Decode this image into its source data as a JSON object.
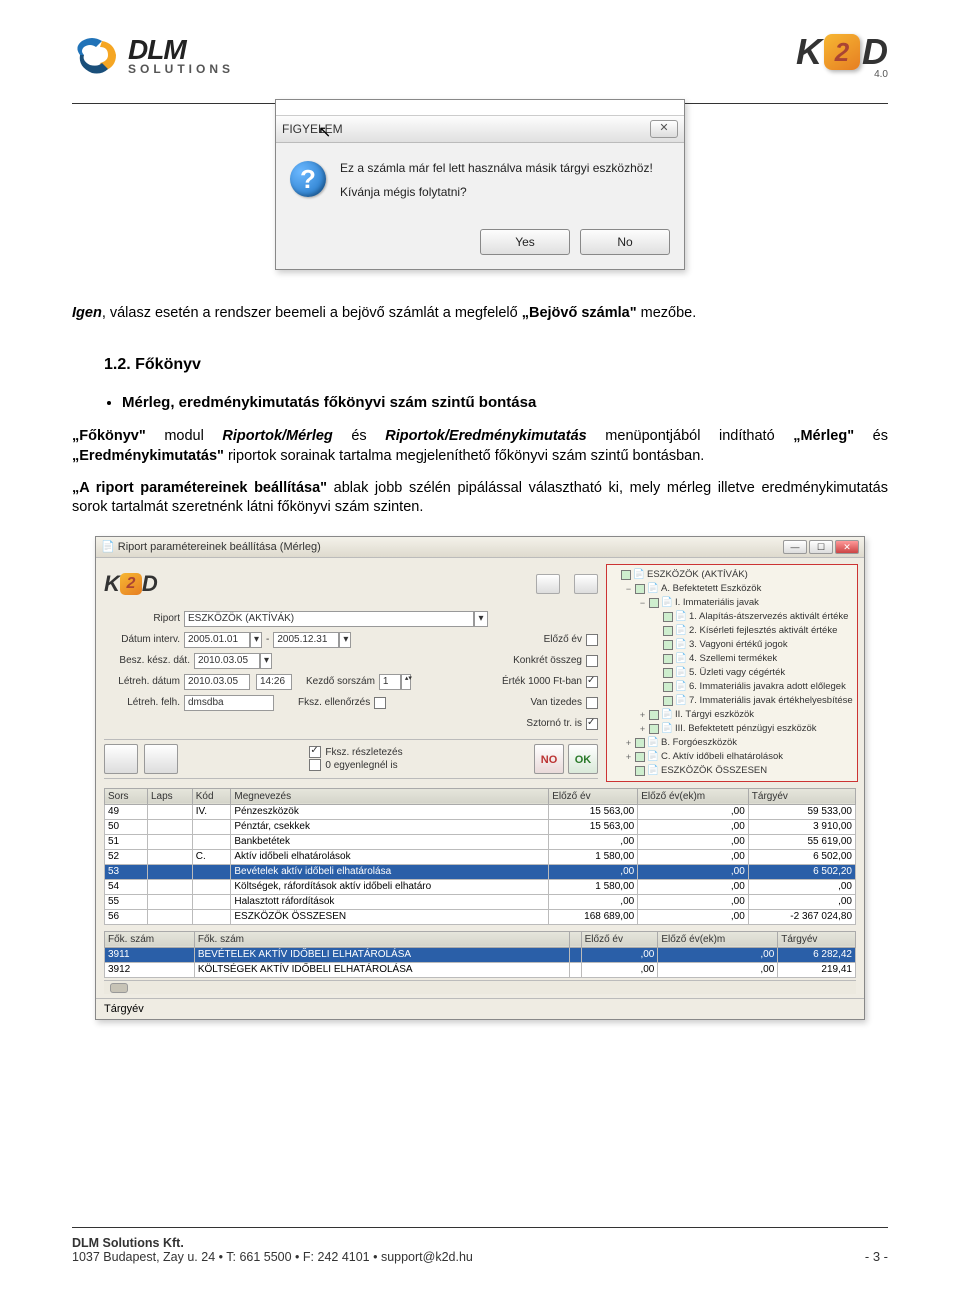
{
  "header": {
    "dlm_line1": "DLM",
    "dlm_line2": "SOLUTIONS",
    "k2d_k": "K",
    "k2d_2": "2",
    "k2d_d": "D",
    "k2d_ver": "4.0"
  },
  "dialog1": {
    "title": "FIGYELEM",
    "line1": "Ez a számla már fel lett használva másik tárgyi eszközhöz!",
    "line2": "Kívánja mégis folytatni?",
    "yes": "Yes",
    "no": "No",
    "close": "✕"
  },
  "body": {
    "p1a": "Igen",
    "p1b": ", válasz esetén a rendszer beemeli a bejövő számlát a megfelelő ",
    "p1c": "„Bejövő számla\"",
    "p1d": " mezőbe.",
    "sect": "1.2.   Főkönyv",
    "bullet": "Mérleg, eredménykimutatás főkönyvi szám szintű bontása",
    "p2a": "„Főkönyv\"",
    "p2b": " modul ",
    "p2c": "Riportok/Mérleg",
    "p2d": " és ",
    "p2e": "Riportok/Eredménykimutatás",
    "p2f": " menüpontjából indítható ",
    "p2g": "„Mérleg\"",
    "p2h": " és ",
    "p2i": "„Eredménykimutatás\"",
    "p2j": " riportok sorainak tartalma megjeleníthető főkönyvi szám szintű bontásban.",
    "p3a": "„A riport paramétereinek beállítása\"",
    "p3b": " ablak jobb szélén pipálással választható ki, mely mérleg illetve eredménykimutatás sorok tartalmát szeretnénk látni főkönyvi szám szinten."
  },
  "shot2": {
    "title": "Riport paramétereinek beállítása  (Mérleg)",
    "form": {
      "riport_lbl": "Riport",
      "riport_val": "ESZKÖZÖK (AKTÍVÁK)",
      "datum_lbl": "Dátum interv.",
      "datum_from": "2005.01.01",
      "datum_to": "2005.12.31",
      "elozo_ev": "Előző év",
      "besz_lbl": "Besz. kész. dát.",
      "besz_val": "2010.03.05",
      "konkret": "Konkrét összeg",
      "letreh_d_lbl": "Létreh. dátum",
      "letreh_d_val": "2010.03.05",
      "letreh_t_val": "14:26",
      "kezdo_lbl": "Kezdő sorszám",
      "kezdo_val": "1",
      "ertek1000": "Érték 1000 Ft-ban",
      "letreh_f_lbl": "Létreh. felh.",
      "letreh_f_val": "dmsdba",
      "fksz_ell": "Fksz. ellenőrzés",
      "van_tizedes": "Van tizedes",
      "sztorno": "Sztornó tr. is",
      "fksz_resz": "Fksz. részletezés",
      "egyenleg": "0 egyenlegnél is",
      "no": "NO",
      "ok": "OK"
    },
    "tree": [
      [
        "",
        "",
        "ESZKÖZÖK (AKTÍVÁK)"
      ],
      [
        "−",
        "1",
        "A. Befektetett Eszközök"
      ],
      [
        "−",
        "2",
        "I. Immateriális javak"
      ],
      [
        "",
        "3",
        "1. Alapítás-átszervezés aktivált értéke"
      ],
      [
        "",
        "3",
        "2. Kísérleti fejlesztés aktivált értéke"
      ],
      [
        "",
        "3",
        "3. Vagyoni értékű jogok"
      ],
      [
        "",
        "3",
        "4. Szellemi termékek"
      ],
      [
        "",
        "3",
        "5. Üzleti vagy cégérték"
      ],
      [
        "",
        "3",
        "6. Immateriális javakra adott előlegek"
      ],
      [
        "",
        "3",
        "7. Immateriális javak értékhelyesbítése"
      ],
      [
        "+",
        "2",
        "II. Tárgyi eszközök"
      ],
      [
        "+",
        "2",
        "III. Befektetett pénzügyi eszközök"
      ],
      [
        "+",
        "1",
        "B. Forgóeszközök"
      ],
      [
        "+",
        "1",
        "C. Aktív időbeli elhatárolások"
      ],
      [
        "",
        "1",
        "ESZKÖZÖK ÖSSZESEN"
      ]
    ],
    "table1": {
      "headers": [
        "Sors",
        "Laps",
        "Kód",
        "Megnevezés",
        "Előző év",
        "Előző év(ek)m",
        "Tárgyév"
      ],
      "rows": [
        [
          "49",
          "",
          "IV.",
          "Pénzeszközök",
          "15 563,00",
          ",00",
          "59 533,00"
        ],
        [
          "50",
          "",
          "",
          "Pénztár, csekkek",
          "15 563,00",
          ",00",
          "3 910,00"
        ],
        [
          "51",
          "",
          "",
          "Bankbetétek",
          ",00",
          ",00",
          "55 619,00"
        ],
        [
          "52",
          "",
          "C.",
          "Aktív időbeli elhatárolások",
          "1 580,00",
          ",00",
          "6 502,00"
        ],
        [
          "53",
          "",
          "",
          "Bevételek aktív időbeli elhatárolása",
          ",00",
          ",00",
          "6 502,20"
        ],
        [
          "54",
          "",
          "",
          "Költségek, ráfordítások aktív időbeli elhatáro",
          "1 580,00",
          ",00",
          ",00"
        ],
        [
          "55",
          "",
          "",
          "Halasztott ráfordítások",
          ",00",
          ",00",
          ",00"
        ],
        [
          "56",
          "",
          "",
          "ESZKÖZÖK ÖSSZESEN",
          "168 689,00",
          ",00",
          "-2 367 024,80"
        ]
      ],
      "sel": 4
    },
    "table2": {
      "headers": [
        "Fők. szám",
        "Fők. szám",
        "",
        "Előző év",
        "Előző év(ek)m",
        "Tárgyév"
      ],
      "rows": [
        [
          "3911",
          "BEVÉTELEK AKTÍV IDŐBELI ELHATÁROLÁSA",
          "",
          ",00",
          ",00",
          "6 282,42"
        ],
        [
          "3912",
          "KÖLTSÉGEK AKTÍV IDŐBELI ELHATÁROLÁSA",
          "",
          ",00",
          ",00",
          "219,41"
        ]
      ],
      "sel": 0
    },
    "status": "Tárgyév"
  },
  "footer": {
    "line1": "DLM Solutions Kft.",
    "line2": "1037 Budapest, Zay u. 24  •  T: 661 5500 • F: 242 4101 • support@k2d.hu",
    "page": "- 3 -"
  }
}
